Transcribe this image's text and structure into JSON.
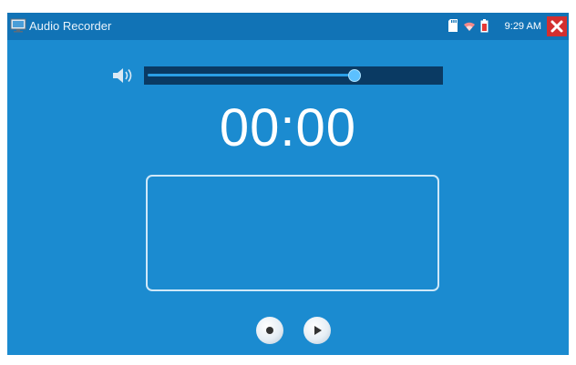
{
  "window": {
    "title": "Audio Recorder",
    "app_icon": "monitor-icon"
  },
  "status_bar": {
    "icons": [
      "sd-card-icon",
      "wifi-icon",
      "battery-icon"
    ],
    "time": "9:29 AM",
    "close_icon": "close-icon"
  },
  "recorder": {
    "volume_icon": "speaker-icon",
    "volume_level": 0.71,
    "timer": "00:00",
    "record_button_icon": "record-icon",
    "play_button_icon": "play-icon"
  },
  "colors": {
    "background": "#1b8bd0",
    "titlebar": "#1173b6",
    "volume_track": "#0a3a63",
    "close": "#d32f2f"
  }
}
